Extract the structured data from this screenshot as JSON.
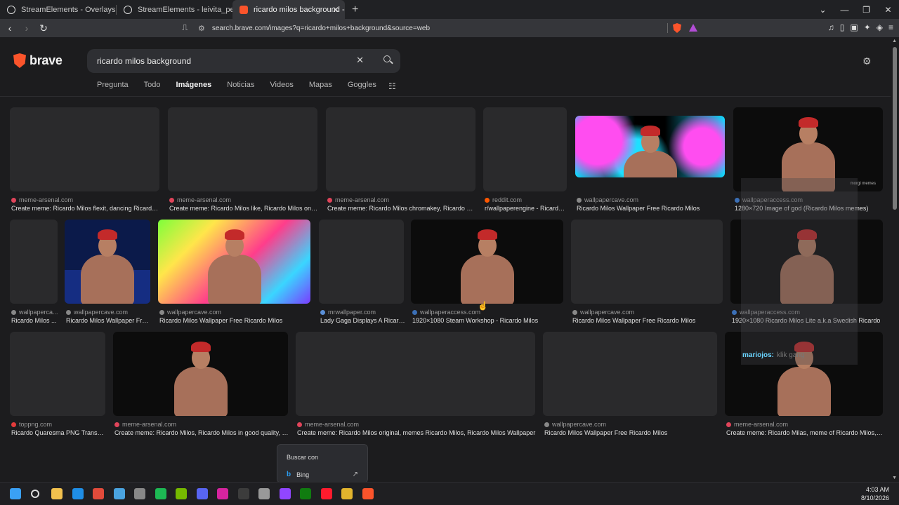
{
  "browser": {
    "tabs": [
      {
        "title": "StreamElements - Overlays",
        "active": false
      },
      {
        "title": "StreamElements - leivita_pepita",
        "active": false
      },
      {
        "title": "ricardo milos background - Brave",
        "active": true
      }
    ],
    "new_tab": "+",
    "address": "search.brave.com/images?q=ricardo+milos+background&source=web",
    "window_controls": [
      "⌄",
      "—",
      "❐",
      "✕"
    ]
  },
  "search": {
    "logo": "brave",
    "query": "ricardo milos background",
    "clear": "✕",
    "nav_tabs": [
      {
        "label": "Pregunta",
        "active": false
      },
      {
        "label": "Todo",
        "active": false
      },
      {
        "label": "Imágenes",
        "active": true
      },
      {
        "label": "Noticias",
        "active": false
      },
      {
        "label": "Videos",
        "active": false
      },
      {
        "label": "Mapas",
        "active": false
      },
      {
        "label": "Goggles",
        "active": false
      }
    ]
  },
  "results": [
    {
      "source": "meme-arsenal.com",
      "caption": "Create meme: Ricardo Milos flexit, dancing Ricardo Mi...",
      "color": "#e0445a"
    },
    {
      "source": "meme-arsenal.com",
      "caption": "Create meme: Ricardo Milos like, Ricardo Milos on a g...",
      "color": "#e0445a"
    },
    {
      "source": "meme-arsenal.com",
      "caption": "Create meme: Ricardo Milos chromakey, Ricardo Milo...",
      "color": "#e0445a"
    },
    {
      "source": "reddit.com",
      "caption": "r/wallpaperengine - Ricardo ...",
      "color": "#ff5700"
    },
    {
      "source": "wallpapercave.com",
      "caption": "Ricardo Milos Wallpaper Free Ricardo Milos",
      "color": "#888888"
    },
    {
      "source": "wallpaperaccess.com",
      "caption": "1280×720 Image of god (Ricardo Milos memes)",
      "color": "#3b6fb6"
    },
    {
      "source": "wallpaperca...",
      "caption": "Ricardo Milos ...",
      "color": "#888888"
    },
    {
      "source": "wallpapercave.com",
      "caption": "Ricardo Milos Wallpaper Free...",
      "color": "#888888"
    },
    {
      "source": "wallpapercave.com",
      "caption": "Ricardo Milos Wallpaper Free Ricardo Milos",
      "color": "#888888"
    },
    {
      "source": "mrwallpaper.com",
      "caption": "Lady Gaga Displays A Ricard...",
      "color": "#5a8fd6"
    },
    {
      "source": "wallpaperaccess.com",
      "caption": "1920×1080 Steam Workshop - Ricardo Milos",
      "color": "#3b6fb6"
    },
    {
      "source": "wallpapercave.com",
      "caption": "Ricardo Milos Wallpaper Free Ricardo Milos",
      "color": "#888888"
    },
    {
      "source": "wallpaperaccess.com",
      "caption": "1920×1080 Ricardo Milos Lite a.k.a Swedish Ricardo",
      "color": "#3b6fb6"
    },
    {
      "source": "toppng.com",
      "caption": "Ricardo Quaresma PNG Transpar...",
      "color": "#e23b3b"
    },
    {
      "source": "meme-arsenal.com",
      "caption": "Create meme: Ricardo Milos, Ricardo Milos in good quality, Ric...",
      "color": "#e0445a"
    },
    {
      "source": "meme-arsenal.com",
      "caption": "Create meme: Ricardo Milos original, memes Ricardo Milos, Ricardo Milos Wallpaper",
      "color": "#e0445a"
    },
    {
      "source": "wallpapercave.com",
      "caption": "Ricardo Milos Wallpaper Free Ricardo Milos",
      "color": "#888888"
    },
    {
      "source": "meme-arsenal.com",
      "caption": "Create meme: Ricardo Milas, meme of Ricardo Milos, Ric...",
      "color": "#e0445a"
    }
  ],
  "overlay": {
    "watermark": "morgi memes",
    "chat_user": "mariojos:",
    "chat_msg": "klik gang"
  },
  "context_menu": {
    "title": "Buscar con",
    "item": "Bing"
  },
  "taskbar": {
    "time": "4:03 AM",
    "date": "8/10/2026"
  },
  "colors": {
    "brand": "#fb542b",
    "page_bg": "#1c1c1e"
  }
}
